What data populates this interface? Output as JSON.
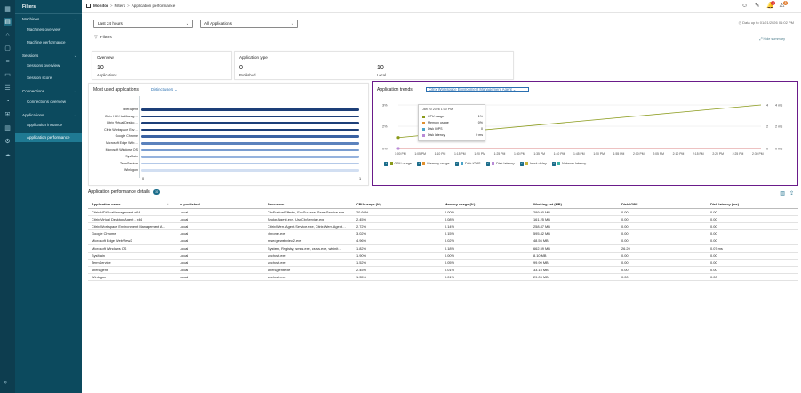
{
  "nav": {
    "filters_label": "Filters",
    "expand_icon": "double-chevron-right-icon",
    "rail_icons": [
      "grid-icon",
      "monitor-icon",
      "bell-icon",
      "settings-icon",
      "list-icon",
      "document-icon",
      "people-icon",
      "pie-icon",
      "shield-icon",
      "building-icon",
      "gear-icon",
      "cloud-icon"
    ],
    "sections": [
      {
        "label": "Machines",
        "items": [
          "Machines overview",
          "Machine performance"
        ]
      },
      {
        "label": "Sessions",
        "items": [
          "Sessions overview",
          "Session score"
        ]
      },
      {
        "label": "Connections",
        "items": [
          "Connections overview"
        ]
      },
      {
        "label": "Applications",
        "items": [
          "Application instance",
          "Application performance"
        ]
      }
    ]
  },
  "header": {
    "breadcrumb": [
      "Monitor",
      "Filters",
      "Application performance"
    ],
    "updated": "Data up to 01/21/2026 01:02 PM",
    "notif_badge": "3",
    "alert_badge": "8",
    "icons": [
      "contacts-icon",
      "feedback-icon",
      "notification-icon",
      "alert-icon"
    ]
  },
  "controls": {
    "time_range": "Last 24 hours",
    "app_filter": "All Applications",
    "filters_label": "Filters"
  },
  "overview": {
    "title": "Overview",
    "applications_count": "10",
    "applications_label": "Applications",
    "type_title": "Application type",
    "published_count": "0",
    "published_label": "Published",
    "local_count": "10",
    "local_label": "Local",
    "hide_summary": "Hide summary"
  },
  "most_used": {
    "title": "Most used applications",
    "dropdown": "Distinct users",
    "axis_min": "0",
    "axis_max": "1",
    "bars": [
      {
        "label": "uberAgent",
        "value": 1,
        "color": "#1d3f78"
      },
      {
        "label": "Citrix HDX IcaManag…",
        "value": 1,
        "color": "#1d3f78"
      },
      {
        "label": "Citrix Virtual Deskto…",
        "value": 1,
        "color": "#1d3f78"
      },
      {
        "label": "Citrix Workspace Env…",
        "value": 1,
        "color": "#1d3f78"
      },
      {
        "label": "Google Chrome",
        "value": 1,
        "color": "#3a62a3"
      },
      {
        "label": "Microsoft Edge Web…",
        "value": 1,
        "color": "#5b82bd"
      },
      {
        "label": "Microsoft Windows OS",
        "value": 1,
        "color": "#7a9dd0"
      },
      {
        "label": "SysMain",
        "value": 1,
        "color": "#96b3de"
      },
      {
        "label": "TermService",
        "value": 1,
        "color": "#b4c9e8"
      },
      {
        "label": "Winlogon",
        "value": 1,
        "color": "#d2dff2"
      }
    ]
  },
  "trends": {
    "title": "Application trends",
    "selected_app": "Citrix Workspace Environment Management Agent",
    "y_left": [
      "3%",
      "2%",
      "0%"
    ],
    "y_right": [
      [
        "4",
        "4 ms"
      ],
      [
        "2",
        "2 ms"
      ],
      [
        "0",
        "0 ms"
      ]
    ],
    "x_ticks": [
      "1:00 PM",
      "1:05 PM",
      "1:10 PM",
      "1:15 PM",
      "1:20 PM",
      "1:25 PM",
      "1:30 PM",
      "1:35 PM",
      "1:40 PM",
      "1:45 PM",
      "1:50 PM",
      "1:55 PM",
      "2:00 PM",
      "2:05 PM",
      "2:10 PM",
      "2:15 PM",
      "2:20 PM",
      "2:25 PM",
      "2:30 PM"
    ],
    "cpu_line": {
      "start": 1,
      "end": 4,
      "color": "#8a9a1a"
    },
    "memory_line": {
      "start": 0,
      "end": 0,
      "color": "#d35f5f"
    },
    "legend": [
      {
        "label": "CPU usage",
        "color": "#8a9a1a"
      },
      {
        "label": "Memory usage",
        "color": "#e09030"
      },
      {
        "label": "Disk IOPS",
        "color": "#4aa3c8"
      },
      {
        "label": "Disk latency",
        "color": "#b98ad6"
      },
      {
        "label": "Input delay",
        "color": "#c9b43a"
      },
      {
        "label": "Network latency",
        "color": "#3bb3a6"
      }
    ],
    "tooltip": {
      "header": "Jan 20 2026 1:00 PM",
      "rows": [
        {
          "k": "CPU usage",
          "v": "1%",
          "color": "#8a9a1a"
        },
        {
          "k": "Memory usage",
          "v": "0%",
          "color": "#e09030"
        },
        {
          "k": "Disk IOPS",
          "v": "0",
          "color": "#4aa3c8"
        },
        {
          "k": "Disk latency",
          "v": "0 ms",
          "color": "#b98ad6"
        }
      ]
    }
  },
  "details": {
    "title": "Application performance details",
    "count": "10",
    "columns": [
      "Application name",
      "Is published",
      "Processes",
      "CPU usage (%)",
      "Memory usage (%)",
      "Working set (MB)",
      "Disk IOPS",
      "Disk latency (ms)"
    ],
    "rows": [
      [
        "Citrix HDX IcaManagement x64",
        "Local",
        "CtxFeatureEffects, EncSvc.exe, SemsService.exe",
        "20.60%",
        "0.00%",
        "299.90 MB",
        "0.00",
        "0.00"
      ],
      [
        "Citrix Virtual Desktop Agent - x64",
        "Local",
        "BrokerAgent.exe, UsbCtxService.exe",
        "2.45%",
        "0.08%",
        "161.25 MB",
        "0.00",
        "0.00"
      ],
      [
        "Citrix Workspace Environment Management A…",
        "Local",
        "Citrix.Wem.Agent.Service.exe, Citrix.Wem.Agent…",
        "2.72%",
        "0.14%",
        "258.87 MB",
        "0.00",
        "0.00"
      ],
      [
        "Google Chrome",
        "Local",
        "chrome.exe",
        "3.02%",
        "0.15%",
        "595.82 MB",
        "0.00",
        "0.00"
      ],
      [
        "Microsoft Edge WebView2",
        "Local",
        "msedgewebview2.exe",
        "4.96%",
        "0.02%",
        "48.56 MB",
        "0.00",
        "0.00"
      ],
      [
        "Microsoft Windows OS",
        "Local",
        "System, Registry, smss.exe, csrss.exe, wininit…",
        "1.82%",
        "0.18%",
        "662.59 MB",
        "26.20",
        "0.07 ms"
      ],
      [
        "SysMain",
        "Local",
        "svchost.exe",
        "1.90%",
        "0.00%",
        "8.10 MB",
        "0.00",
        "0.00"
      ],
      [
        "TermService",
        "Local",
        "svchost.exe",
        "1.52%",
        "0.05%",
        "99.90 MB",
        "0.00",
        "0.00"
      ],
      [
        "uberAgent",
        "Local",
        "uberAgent.exe",
        "2.45%",
        "0.01%",
        "33.15 MB",
        "0.00",
        "0.00"
      ],
      [
        "Winlogon",
        "Local",
        "svchost.exe",
        "1.35%",
        "0.01%",
        "29.05 MB",
        "0.00",
        "0.00"
      ]
    ]
  }
}
